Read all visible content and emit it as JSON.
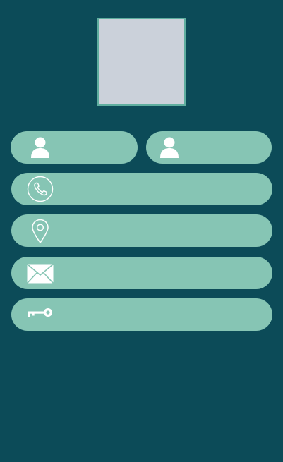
{
  "form": {
    "first_name": {
      "value": "",
      "placeholder": "",
      "icon": "user-icon"
    },
    "last_name": {
      "value": "",
      "placeholder": "",
      "icon": "user-icon"
    },
    "phone": {
      "value": "",
      "placeholder": "",
      "icon": "phone-icon"
    },
    "address": {
      "value": "",
      "placeholder": "",
      "icon": "location-pin-icon"
    },
    "email": {
      "value": "",
      "placeholder": "",
      "icon": "envelope-icon"
    },
    "password": {
      "value": "",
      "placeholder": "",
      "icon": "key-icon"
    }
  },
  "colors": {
    "background": "#0c4b58",
    "field": "#86c5b4",
    "avatar_placeholder": "#cbd1da",
    "avatar_border": "#5fae9f",
    "icon": "#ffffff"
  }
}
